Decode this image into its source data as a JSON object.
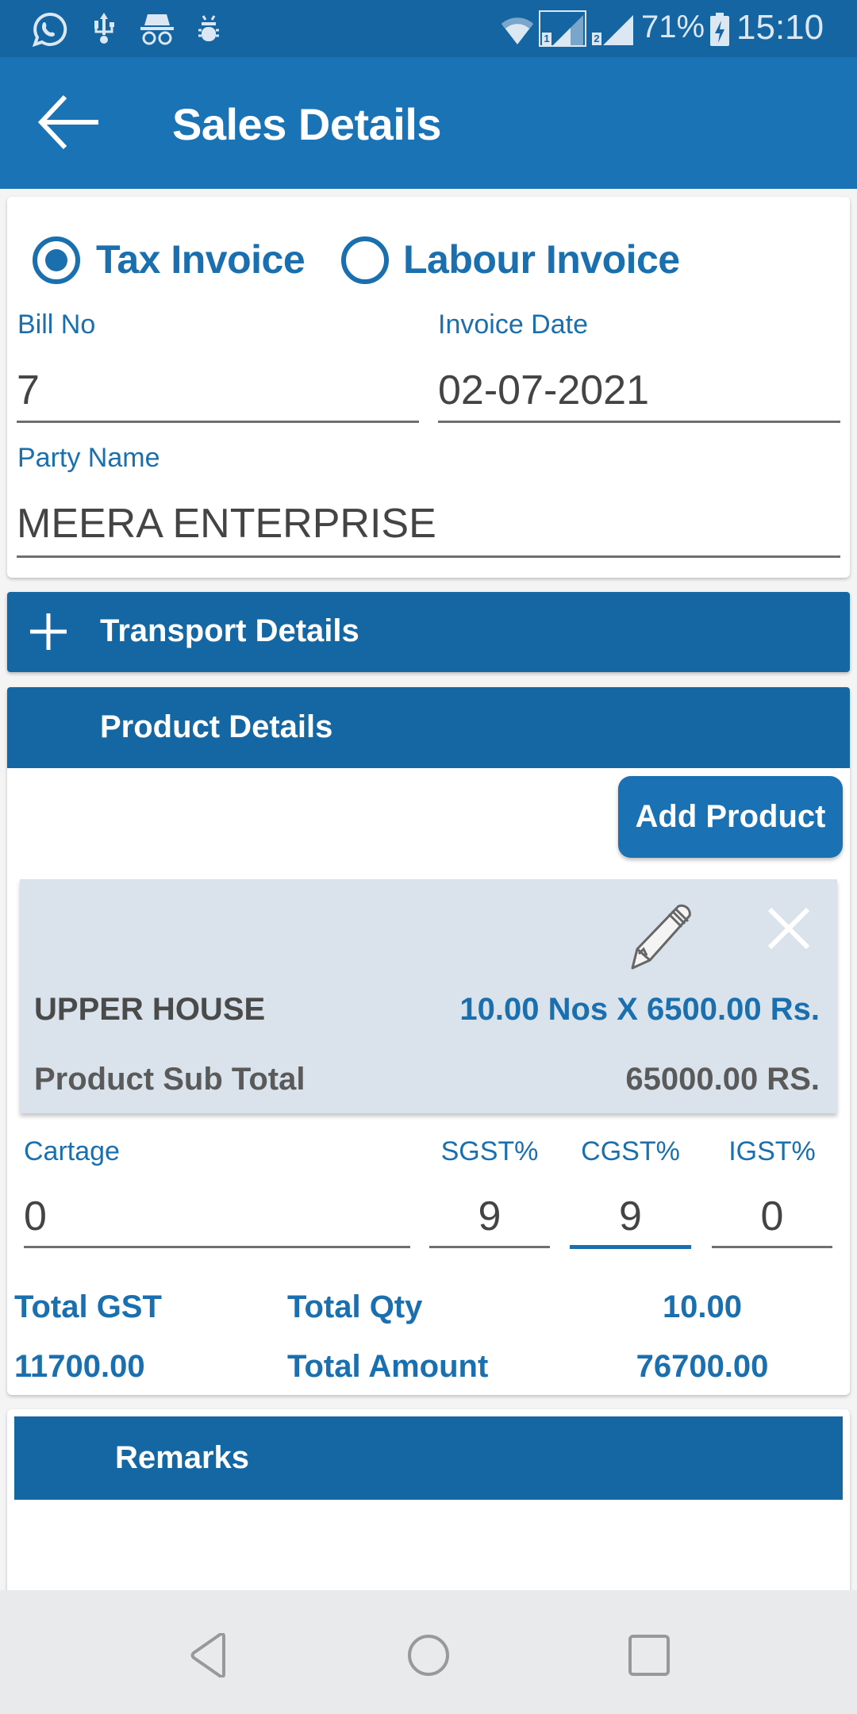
{
  "status_bar": {
    "icons_left": [
      "whatsapp-icon",
      "usb-icon",
      "incognito-icon",
      "bug-icon"
    ],
    "icons_right": [
      "wifi-icon",
      "sim1-signal-icon",
      "sim2-signal-icon",
      "battery-charging-icon"
    ],
    "battery": "71%",
    "time": "15:10"
  },
  "app_bar": {
    "back_icon": "arrow-left-icon",
    "title": "Sales Details"
  },
  "invoice_type": {
    "options": [
      {
        "label": "Tax Invoice",
        "selected": true
      },
      {
        "label": "Labour Invoice",
        "selected": false
      }
    ]
  },
  "fields": {
    "bill_no": {
      "label": "Bill No",
      "value": "7"
    },
    "invoice_date": {
      "label": "Invoice Date",
      "value": "02-07-2021"
    },
    "party_name": {
      "label": "Party Name",
      "value": "MEERA ENTERPRISE"
    }
  },
  "transport": {
    "icon": "plus-icon",
    "title": "Transport Details"
  },
  "product_details": {
    "title": "Product Details",
    "add_button": "Add Product",
    "items": [
      {
        "name": "UPPER HOUSE",
        "qty_price": "10.00 Nos X 6500.00 Rs.",
        "subtotal_label": "Product Sub Total",
        "subtotal": "65000.00 RS.",
        "edit_icon": "pencil-icon",
        "delete_icon": "close-icon"
      }
    ]
  },
  "charges": {
    "cartage": {
      "label": "Cartage",
      "value": "0"
    },
    "sgst": {
      "label": "SGST%",
      "value": "9"
    },
    "cgst": {
      "label": "CGST%",
      "value": "9"
    },
    "igst": {
      "label": "IGST%",
      "value": "0"
    }
  },
  "totals": {
    "total_gst_label": "Total GST",
    "total_gst": "11700.00",
    "total_qty_label": "Total Qty",
    "total_qty": "10.00",
    "total_amount_label": "Total Amount",
    "total_amount": "76700.00"
  },
  "remarks": {
    "title": "Remarks"
  },
  "nav_bar": {
    "buttons": [
      "back-triangle-icon",
      "home-circle-icon",
      "recents-square-icon"
    ]
  },
  "colors": {
    "primary": "#1a73b5",
    "status_bar": "#1565a3",
    "section_bar": "#1567a3",
    "item_card": "#dae3ec"
  }
}
